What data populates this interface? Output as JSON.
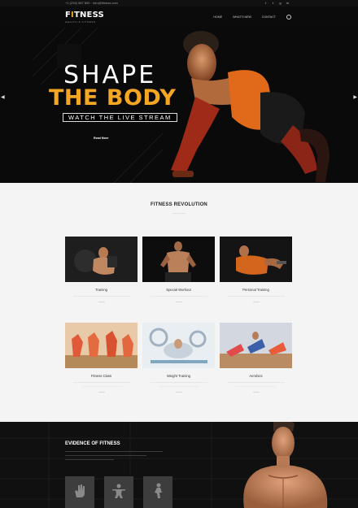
{
  "topbar": {
    "contact": "+1 (234) 567 890  ·  info@fitness.com",
    "social": [
      "f",
      "t",
      "g",
      "in"
    ]
  },
  "header": {
    "logo_prefix": "F",
    "logo_accent": "I",
    "logo_suffix": "TNESS",
    "logo_tag": "HEALTH & FITNESS",
    "nav": [
      "HOME",
      "WHAT'S NEW",
      "CONTACT"
    ]
  },
  "hero": {
    "title_line1": "SHAPE",
    "title_line2": "THE BODY",
    "subtitle": "WATCH THE LIVE STREAM",
    "button": "Read More"
  },
  "revolution": {
    "title": "FITNESS REVOLUTION",
    "cards": [
      {
        "caption": "Training"
      },
      {
        "caption": "Special Workout"
      },
      {
        "caption": "Personal Training"
      },
      {
        "caption": "Fitness Class"
      },
      {
        "caption": "Weight Training"
      },
      {
        "caption": "Aerobics"
      }
    ]
  },
  "evidence": {
    "title": "EVIDENCE OF FITNESS"
  },
  "colors": {
    "accent": "#f5a623",
    "dark": "#0b0b0b",
    "tile": "#3d3d3d"
  },
  "icons": [
    "facebook-icon",
    "twitter-icon",
    "google-plus-icon",
    "instagram-icon",
    "search-icon",
    "arrow-left-icon",
    "arrow-right-icon",
    "hand-icon",
    "dumbbell-icon",
    "figure-icon"
  ]
}
